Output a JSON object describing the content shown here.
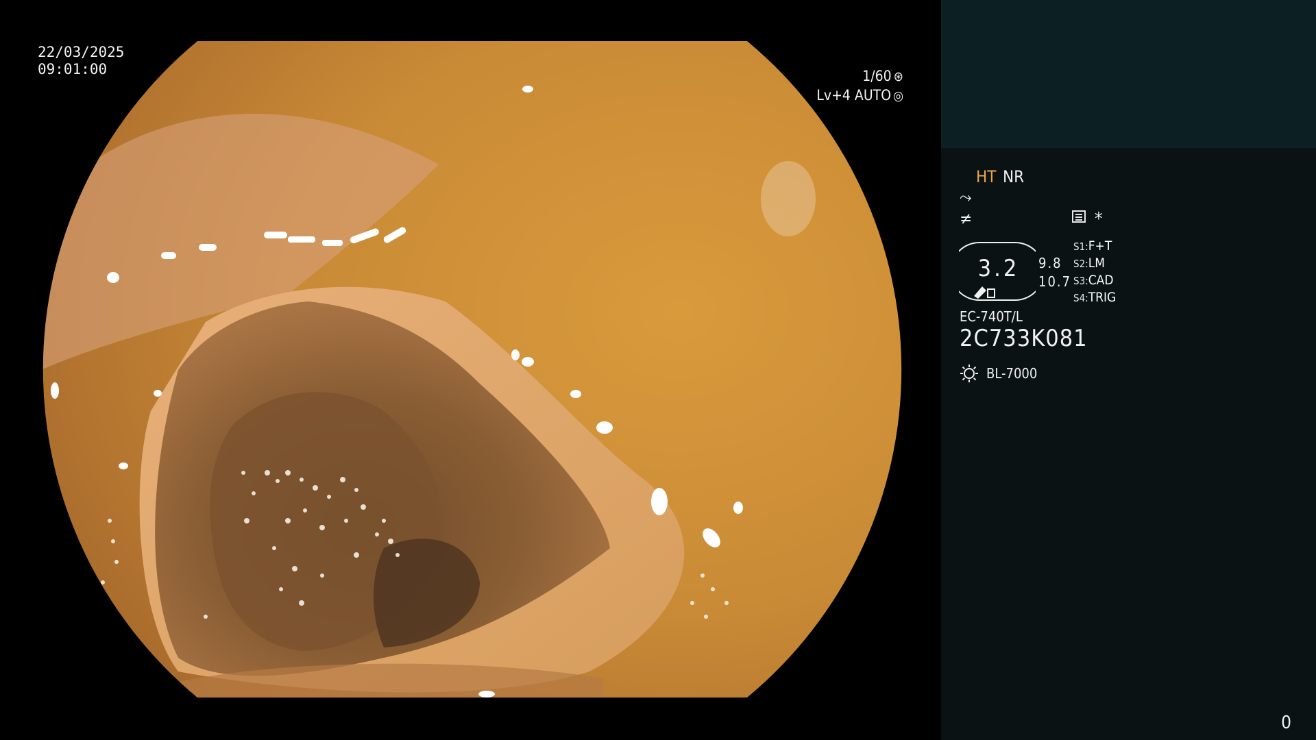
{
  "osd": {
    "date": "22/03/2025",
    "time": "09:01:00",
    "shutter": "1/60",
    "shutter_icon": "aperture-icon",
    "level": "Lv+4 AUTO",
    "level_icon": "target-icon"
  },
  "panel": {
    "ht": "HT",
    "nr": "NR",
    "edge_icon": "⤳",
    "neq_icon": "≠",
    "star": "*",
    "zoom": "3.2",
    "val_a": "9.8",
    "val_b": "10.7",
    "switches": [
      {
        "key": "S1:",
        "value": "F+T"
      },
      {
        "key": "S2:",
        "value": "LM"
      },
      {
        "key": "S3:",
        "value": "CAD"
      },
      {
        "key": "S4:",
        "value": "TRIG"
      }
    ],
    "model": "EC-740T/L",
    "serial": "2C733K081",
    "light_source": "BL-7000",
    "light_icon": "sun-icon",
    "counter": "0"
  },
  "colors": {
    "panel_bg": "#0a1213",
    "panel_top": "#0c1f22",
    "ht": "#f0a44a",
    "mucosa": "#c98a36"
  }
}
